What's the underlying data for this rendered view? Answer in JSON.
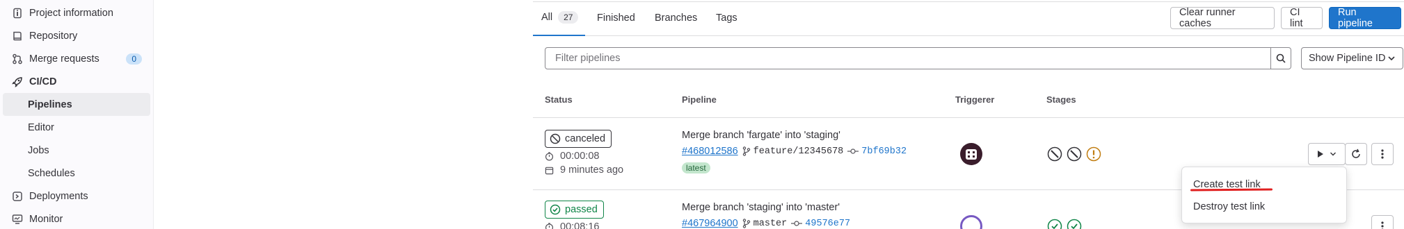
{
  "sidebar": {
    "items": [
      {
        "label": "Project information",
        "icon": "project-info-icon"
      },
      {
        "label": "Repository",
        "icon": "repository-icon"
      },
      {
        "label": "Merge requests",
        "icon": "merge-request-icon",
        "count": "0"
      },
      {
        "label": "CI/CD",
        "icon": "rocket-icon"
      },
      {
        "label": "Pipelines"
      },
      {
        "label": "Editor"
      },
      {
        "label": "Jobs"
      },
      {
        "label": "Schedules"
      },
      {
        "label": "Deployments",
        "icon": "deployments-icon"
      },
      {
        "label": "Monitor",
        "icon": "monitor-icon"
      }
    ]
  },
  "tabs": [
    {
      "label": "All",
      "count": "27"
    },
    {
      "label": "Finished"
    },
    {
      "label": "Branches"
    },
    {
      "label": "Tags"
    }
  ],
  "toolbar": {
    "clear_cache_label": "Clear runner caches",
    "ci_lint_label": "CI lint",
    "run_pipeline_label": "Run pipeline"
  },
  "filter": {
    "placeholder": "Filter pipelines",
    "show_label": "Show Pipeline ID"
  },
  "table": {
    "headers": [
      "Status",
      "Pipeline",
      "Triggerer",
      "Stages"
    ]
  },
  "pipelines": [
    {
      "status": "canceled",
      "duration": "00:00:08",
      "finished": "9 minutes ago",
      "title": "Merge branch 'fargate' into 'staging'",
      "id": "#468012586",
      "ref": "feature/12345678",
      "sha": "7bf69b32",
      "badge": "latest"
    },
    {
      "status": "passed",
      "duration": "00:08:16",
      "title": "Merge branch 'staging' into 'master'",
      "id": "#467964900",
      "ref": "master",
      "sha": "49576e77"
    }
  ],
  "dropdown": {
    "items": [
      "Create test link",
      "Destroy test link"
    ]
  },
  "colors": {
    "accent": "#1f75cb",
    "passed": "#108548",
    "warning": "#c17d10",
    "annotation": "#e02020"
  }
}
